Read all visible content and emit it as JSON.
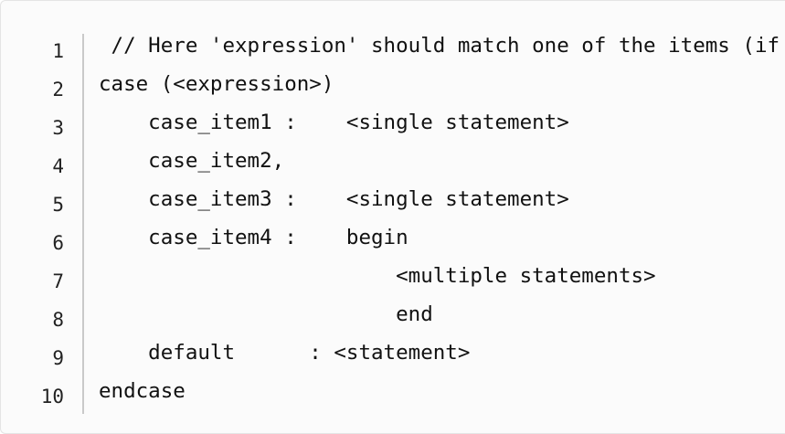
{
  "code_block": {
    "line_numbers": [
      "1",
      "2",
      "3",
      "4",
      "5",
      "6",
      "7",
      "8",
      "9",
      "10"
    ],
    "lines": [
      " // Here 'expression' should match one of the items (if",
      "case (<expression>)",
      "    case_item1 :    <single statement>",
      "    case_item2,",
      "    case_item3 :    <single statement>",
      "    case_item4 :    begin",
      "                        <multiple statements>",
      "                        end",
      "    default      : <statement>",
      "endcase"
    ]
  }
}
